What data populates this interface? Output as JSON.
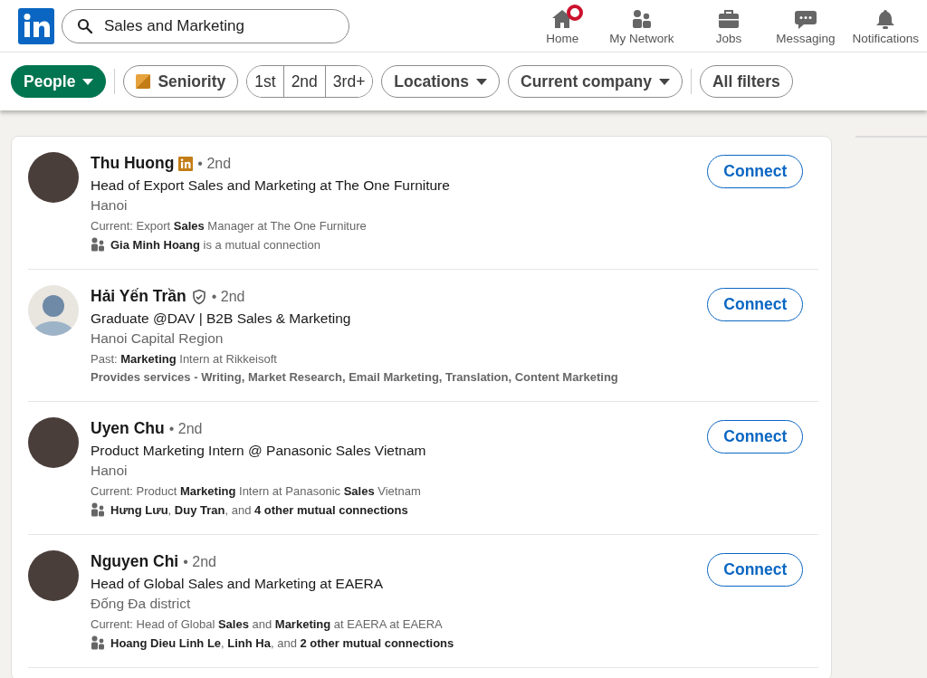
{
  "search": {
    "value": "Sales and Marketing"
  },
  "nav": [
    {
      "label": "Home",
      "has_notification": true
    },
    {
      "label": "My Network",
      "has_notification": false
    },
    {
      "label": "Jobs",
      "has_notification": false
    },
    {
      "label": "Messaging",
      "has_notification": false
    },
    {
      "label": "Notifications",
      "has_notification": false
    }
  ],
  "filters": [
    {
      "kind": "dropdown",
      "label": "People",
      "selected": true
    },
    {
      "kind": "divider"
    },
    {
      "kind": "icon",
      "label": "Seniority",
      "selected": false
    },
    {
      "kind": "group",
      "options": [
        {
          "label": "1st",
          "selected": false
        },
        {
          "label": "2nd",
          "selected": false
        },
        {
          "label": "3rd+",
          "selected": false
        }
      ]
    },
    {
      "kind": "dropdown",
      "label": "Locations",
      "selected": false
    },
    {
      "kind": "dropdown",
      "label": "Current company",
      "selected": false
    },
    {
      "kind": "divider"
    },
    {
      "kind": "plain",
      "label": "All filters",
      "selected": false
    }
  ],
  "results": [
    {
      "name": "Thu Huong",
      "premium": true,
      "verified": false,
      "degree": "• 2nd",
      "has_photo": true,
      "headline": "Head of Export Sales and Marketing at The One Furniture",
      "location": "Hanoi",
      "summary": "Current: Export **Sales** Manager at The One Furniture",
      "insight": {
        "kind": "mutual",
        "text": "**Gia Minh Hoang** is a mutual connection"
      },
      "action": "Connect"
    },
    {
      "name": "Hải Yến Trần",
      "premium": false,
      "verified": true,
      "degree": "• 2nd",
      "has_photo": false,
      "headline": "Graduate @DAV | B2B Sales & Marketing",
      "location": "Hanoi Capital Region",
      "summary": "Past: **Marketing** Intern at Rikkeisoft",
      "insight": {
        "kind": "services",
        "text": "Provides services - Writing, Market Research, Email Marketing, Translation, Content Marketing"
      },
      "action": "Connect"
    },
    {
      "name": "Uyen Chu",
      "premium": false,
      "verified": false,
      "degree": "• 2nd",
      "has_photo": true,
      "headline": "Product Marketing Intern @ Panasonic Sales Vietnam",
      "location": "Hanoi",
      "summary": "Current: Product **Marketing** Intern at Panasonic **Sales** Vietnam",
      "insight": {
        "kind": "mutual",
        "text": "**Hưng Lưu**, **Duy Tran**, and **4 other mutual connections**"
      },
      "action": "Connect"
    },
    {
      "name": "Nguyen Chi",
      "premium": false,
      "verified": false,
      "degree": "• 2nd",
      "has_photo": true,
      "headline": "Head of Global Sales and Marketing at EAERA",
      "location": "Đống Đa district",
      "summary": "Current: Head of Global **Sales** and **Marketing** at EAERA at EAERA",
      "insight": {
        "kind": "mutual",
        "text": "**Hoang Dieu Linh Le**, **Linh Ha**, and **2 other mutual connections**"
      },
      "action": "Connect"
    }
  ]
}
